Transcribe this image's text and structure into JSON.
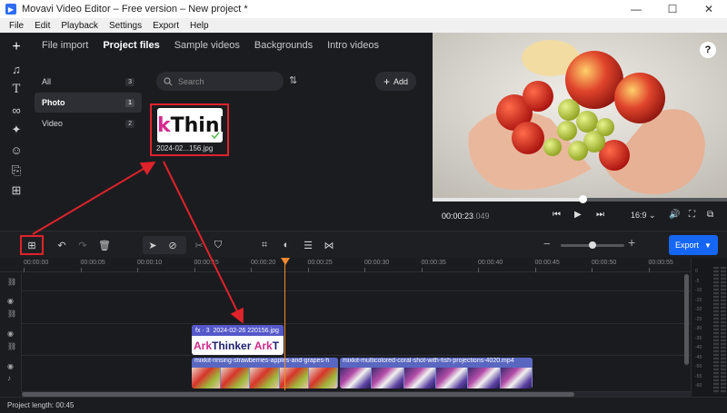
{
  "window": {
    "title": "Movavi Video Editor – Free version – New project *",
    "minimize": "—",
    "maximize": "☐",
    "close": "✕"
  },
  "menu": [
    "File",
    "Edit",
    "Playback",
    "Settings",
    "Export",
    "Help"
  ],
  "import_panel": {
    "tabs": [
      {
        "label": "File import",
        "active": false
      },
      {
        "label": "Project files",
        "active": true
      },
      {
        "label": "Sample videos",
        "active": false
      },
      {
        "label": "Backgrounds",
        "active": false
      },
      {
        "label": "Intro videos",
        "active": false
      }
    ],
    "categories": [
      {
        "label": "All",
        "count": "3",
        "active": false
      },
      {
        "label": "Photo",
        "count": "1",
        "active": true
      },
      {
        "label": "Video",
        "count": "2",
        "active": false
      }
    ],
    "search_placeholder": "Search",
    "add_label": "Add",
    "media_item": {
      "thumb_text_prefix": "k",
      "thumb_text_rest": "Thinl",
      "name": "2024-02...156.jpg"
    }
  },
  "player": {
    "timecode_main": "00:00:23",
    "timecode_frac": ".049",
    "aspect": "16:9",
    "aspect_chevron": "⌄",
    "progress": 0.51
  },
  "timeline": {
    "export_label": "Export",
    "zoom_level": 0.5,
    "ruler_ticks": [
      "00:00:00",
      "00:00:05",
      "00:00:10",
      "00:00:15",
      "00:00:20",
      "00:00:25",
      "00:00:30",
      "00:00:35",
      "00:00:40",
      "00:00:45",
      "00:00:50",
      "00:00:55"
    ],
    "text_clip": {
      "fx": "fx · 3",
      "title": "2024-02-26 220156.jpg",
      "body_a": "Ark",
      "body_b": "Thinker",
      "body_c": "Ark",
      "body_d": "T"
    },
    "video_clips": [
      {
        "label": "mixkit-rinsing-strawberries-apples-and-grapes-h"
      },
      {
        "label": "mixkit-multicolored-coral-shot-with-fish-projections-4020.mp4"
      }
    ],
    "meter_labels": [
      "0",
      "-5",
      "-10",
      "-15",
      "-20",
      "-25",
      "-30",
      "-35",
      "-40",
      "-45",
      "-50",
      "-55",
      "-60"
    ]
  },
  "status": {
    "project_length": "Project length: 00:45"
  },
  "colors": {
    "accent": "#1566f5",
    "highlight": "#e0232a",
    "playhead": "#f28b2c",
    "text_clip_header": "#5458c9",
    "video_clip": "#6f7cc7"
  }
}
